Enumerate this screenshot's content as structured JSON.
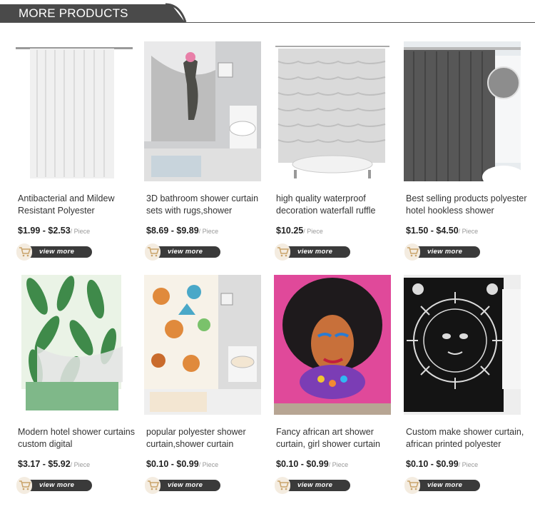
{
  "section": {
    "title": "MORE PRODUCTS"
  },
  "view_more_label": "view more",
  "products": [
    {
      "title": "Antibacterial and Mildew Resistant Polyester",
      "price": "$1.99 - $2.53",
      "unit": "/ Piece",
      "image": "white-curtain"
    },
    {
      "title": "3D bathroom shower curtain sets with rugs,shower",
      "price": "$8.69 - $9.89",
      "unit": "/ Piece",
      "image": "dinosaur-curtain"
    },
    {
      "title": "high quality waterproof decoration waterfall ruffle",
      "price": "$10.25",
      "unit": "/ Piece",
      "image": "ruffle-curtain"
    },
    {
      "title": "Best selling products polyester hotel hookless shower",
      "price": "$1.50 - $4.50",
      "unit": "/ Piece",
      "image": "gray-curtain"
    },
    {
      "title": "Modern hotel shower curtains custom digital",
      "price": "$3.17 - $5.92",
      "unit": "/ Piece",
      "image": "leaf-curtain"
    },
    {
      "title": "popular polyester shower curtain,shower curtain",
      "price": "$0.10 - $0.99",
      "unit": "/ Piece",
      "image": "fox-curtain"
    },
    {
      "title": "Fancy african art shower curtain, girl shower curtain",
      "price": "$0.10 - $0.99",
      "unit": "/ Piece",
      "image": "african-art-curtain"
    },
    {
      "title": "Custom make shower curtain, african printed polyester",
      "price": "$0.10 - $0.99",
      "unit": "/ Piece",
      "image": "sun-moon-curtain"
    }
  ]
}
